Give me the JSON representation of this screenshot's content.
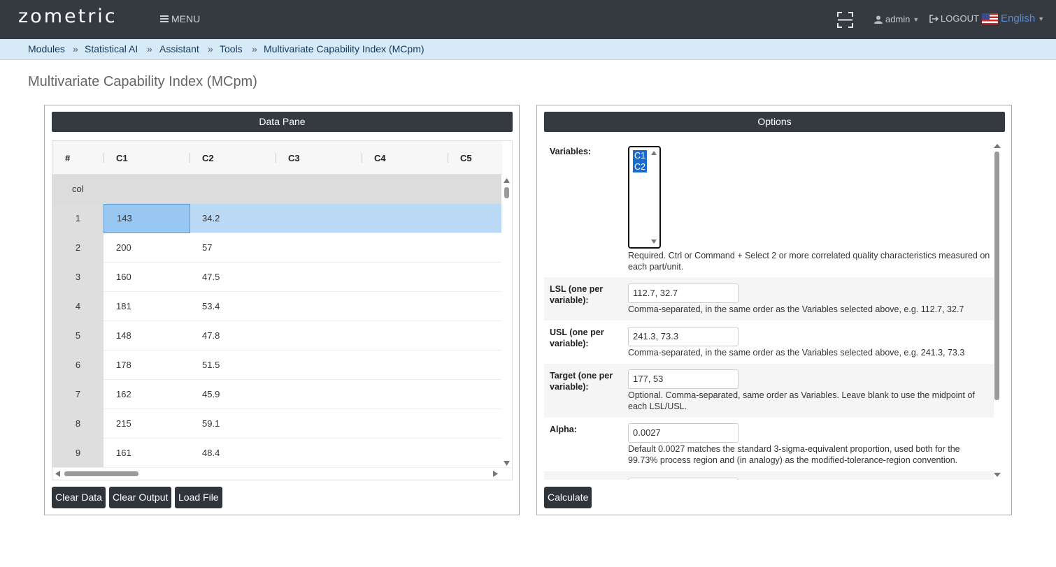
{
  "app": {
    "logo": "zometric",
    "menu_label": "MENU",
    "user": "admin",
    "logout": "LOGOUT",
    "language": "English"
  },
  "breadcrumb": [
    "Modules",
    "Statistical AI",
    "Assistant",
    "Tools",
    "Multivariate Capability Index (MCpm)"
  ],
  "breadcrumb_sep": "»",
  "page_title": "Multivariate Capability Index (MCpm)",
  "data_pane": {
    "title": "Data Pane",
    "columns": [
      "#",
      "C1",
      "C2",
      "C3",
      "C4",
      "C5"
    ],
    "col_row_label": "col",
    "rows": [
      {
        "n": "1",
        "c1": "143",
        "c2": "34.2"
      },
      {
        "n": "2",
        "c1": "200",
        "c2": "57"
      },
      {
        "n": "3",
        "c1": "160",
        "c2": "47.5"
      },
      {
        "n": "4",
        "c1": "181",
        "c2": "53.4"
      },
      {
        "n": "5",
        "c1": "148",
        "c2": "47.8"
      },
      {
        "n": "6",
        "c1": "178",
        "c2": "51.5"
      },
      {
        "n": "7",
        "c1": "162",
        "c2": "45.9"
      },
      {
        "n": "8",
        "c1": "215",
        "c2": "59.1"
      },
      {
        "n": "9",
        "c1": "161",
        "c2": "48.4"
      }
    ],
    "buttons": {
      "clear_data": "Clear Data",
      "clear_output": "Clear Output",
      "load_file": "Load File"
    }
  },
  "options": {
    "title": "Options",
    "variables": {
      "label": "Variables:",
      "selected": [
        "C1",
        "C2"
      ],
      "help": "Required. Ctrl or Command + Select 2 or more correlated quality characteristics measured on each part/unit."
    },
    "lsl": {
      "label": "LSL (one per variable):",
      "value": "112.7, 32.7",
      "help": "Comma-separated, in the same order as the Variables selected above, e.g. 112.7, 32.7"
    },
    "usl": {
      "label": "USL (one per variable):",
      "value": "241.3, 73.3",
      "help": "Comma-separated, in the same order as the Variables selected above, e.g. 241.3, 73.3"
    },
    "target": {
      "label": "Target (one per variable):",
      "value": "177, 53",
      "help": "Optional. Comma-separated, same order as Variables. Leave blank to use the midpoint of each LSL/USL."
    },
    "alpha": {
      "label": "Alpha:",
      "value": "0.0027",
      "help": "Default 0.0027 matches the standard 3-sigma-equivalent proportion, used both for the 99.73% process region and (in analogy) as the modified-tolerance-region convention."
    },
    "calculate": "Calculate"
  }
}
